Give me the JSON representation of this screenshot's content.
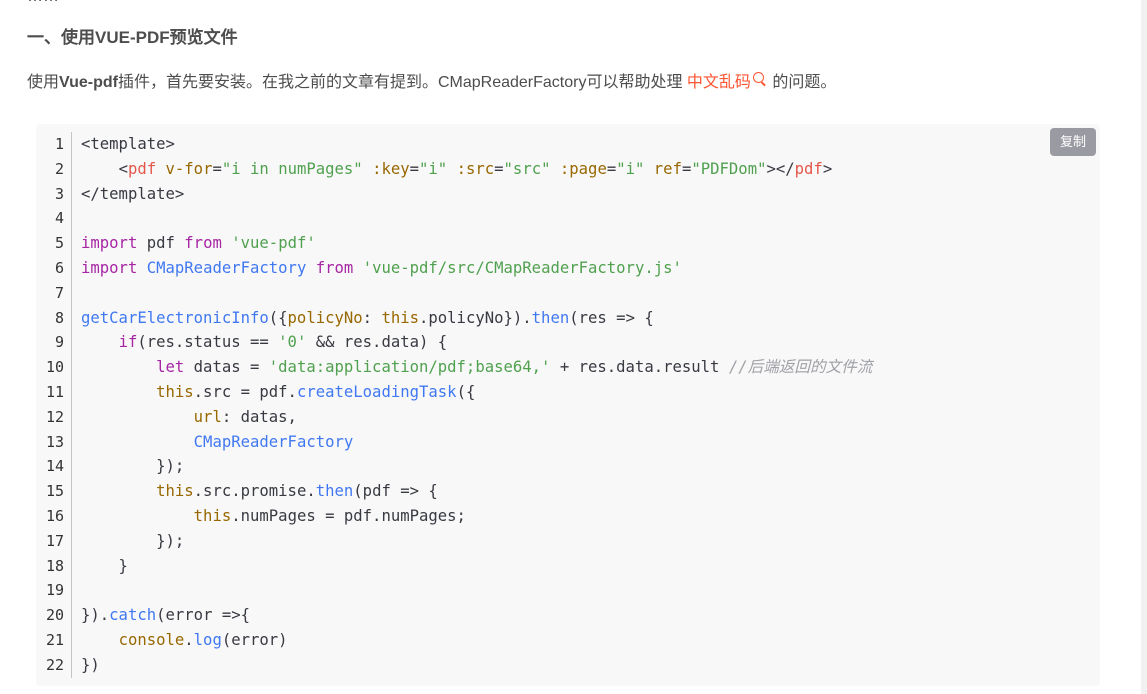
{
  "article": {
    "top_cut_text": "……",
    "heading": "一、使用VUE-PDF预览文件",
    "para_prefix": "使用",
    "para_bold": "Vue-pdf",
    "para_mid": "插件，首先要安装。在我之前的文章有提到。CMapReaderFactory可以帮助处理 ",
    "para_link": "中文乱码",
    "para_suffix": " 的问题。"
  },
  "code_block": {
    "copy_label": "复制",
    "line_numbers": [
      "1",
      "2",
      "3",
      "4",
      "5",
      "6",
      "7",
      "8",
      "9",
      "10",
      "11",
      "12",
      "13",
      "14",
      "15",
      "16",
      "17",
      "18",
      "19",
      "20",
      "21",
      "22"
    ],
    "l1": "<template>",
    "l2_indent": "    ",
    "l2_open": "<",
    "l2_tag": "pdf",
    "l2_attr1": " v-for",
    "l2_eq1": "=",
    "l2_val1": "\"i in numPages\"",
    "l2_attr2": " :key",
    "l2_eq2": "=",
    "l2_val2": "\"i\"",
    "l2_attr3": " :src",
    "l2_eq3": "=",
    "l2_val3": "\"src\"",
    "l2_attr4": " :page",
    "l2_eq4": "=",
    "l2_val4": "\"i\"",
    "l2_attr5": " ref",
    "l2_eq5": "=",
    "l2_val5": "\"PDFDom\"",
    "l2_close": "></",
    "l2_tag2": "pdf",
    "l2_end": ">",
    "l3": "</template>",
    "l5_import": "import",
    "l5_name": " pdf ",
    "l5_from": "from",
    "l5_sp": " ",
    "l5_str": "'vue-pdf'",
    "l6_import": "import",
    "l6_sp1": " ",
    "l6_name": "CMapReaderFactory",
    "l6_sp2": " ",
    "l6_from": "from",
    "l6_sp3": " ",
    "l6_str": "'vue-pdf/src/CMapReaderFactory.js'",
    "l8_fn": "getCarElectronicInfo",
    "l8_p1": "({",
    "l8_key": "policyNo",
    "l8_p2": ": ",
    "l8_this": "this",
    "l8_p3": ".policyNo}).",
    "l8_then": "then",
    "l8_p4": "(res => {",
    "l9_indent": "    ",
    "l9_if": "if",
    "l9_p1": "(res.status == ",
    "l9_str": "'0'",
    "l9_p2": " && res.data) {",
    "l10_indent": "        ",
    "l10_let": "let",
    "l10_p1": " datas = ",
    "l10_str": "'data:application/pdf;base64,'",
    "l10_p2": " + res.data.result ",
    "l10_cmt": "//后端返回的文件流",
    "l11_indent": "        ",
    "l11_this": "this",
    "l11_p1": ".src = pdf.",
    "l11_fn": "createLoadingTask",
    "l11_p2": "({",
    "l12_indent": "            ",
    "l12_key": "url",
    "l12_p": ": datas,",
    "l13_indent": "            ",
    "l13_name": "CMapReaderFactory",
    "l14": "        });",
    "l15_indent": "        ",
    "l15_this": "this",
    "l15_p1": ".src.promise.",
    "l15_then": "then",
    "l15_p2": "(pdf => {",
    "l16_indent": "            ",
    "l16_this": "this",
    "l16_p": ".numPages = pdf.numPages;",
    "l17": "        });",
    "l18": "    }",
    "l20_p1": "}).",
    "l20_catch": "catch",
    "l20_p2": "(error =>{",
    "l21_indent": "    ",
    "l21_console": "console",
    "l21_dot": ".",
    "l21_log": "log",
    "l21_p": "(error)",
    "l22": "})"
  }
}
